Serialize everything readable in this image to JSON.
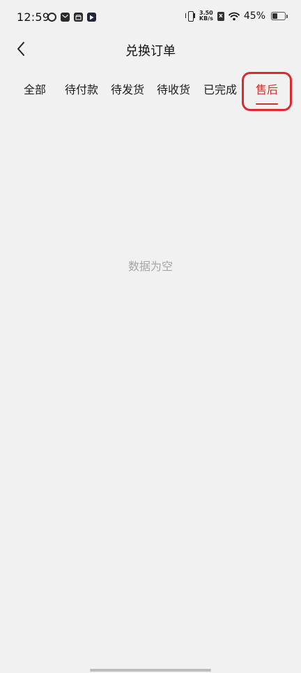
{
  "status_bar": {
    "time": "12:59",
    "net_speed_value": "3.50",
    "net_speed_unit": "KB/s",
    "sim_badge": "x",
    "battery_percent": "45%",
    "battery_level": 0.45,
    "left_icons": [
      "sync-app-icon",
      "mail-app-icon",
      "store-app-icon",
      "play-app-icon"
    ]
  },
  "header": {
    "title": "兑换订单",
    "back_icon": "chevron-left-icon"
  },
  "tabs": [
    {
      "label": "全部",
      "active": false
    },
    {
      "label": "待付款",
      "active": false
    },
    {
      "label": "待发货",
      "active": false
    },
    {
      "label": "待收货",
      "active": false
    },
    {
      "label": "已完成",
      "active": false
    },
    {
      "label": "售后",
      "active": true
    }
  ],
  "empty_state": {
    "message": "数据为空"
  },
  "colors": {
    "accent": "#cc3333",
    "highlight_box": "#e0262e",
    "background": "#f1f1f1",
    "empty_text": "#a6a6a6"
  }
}
